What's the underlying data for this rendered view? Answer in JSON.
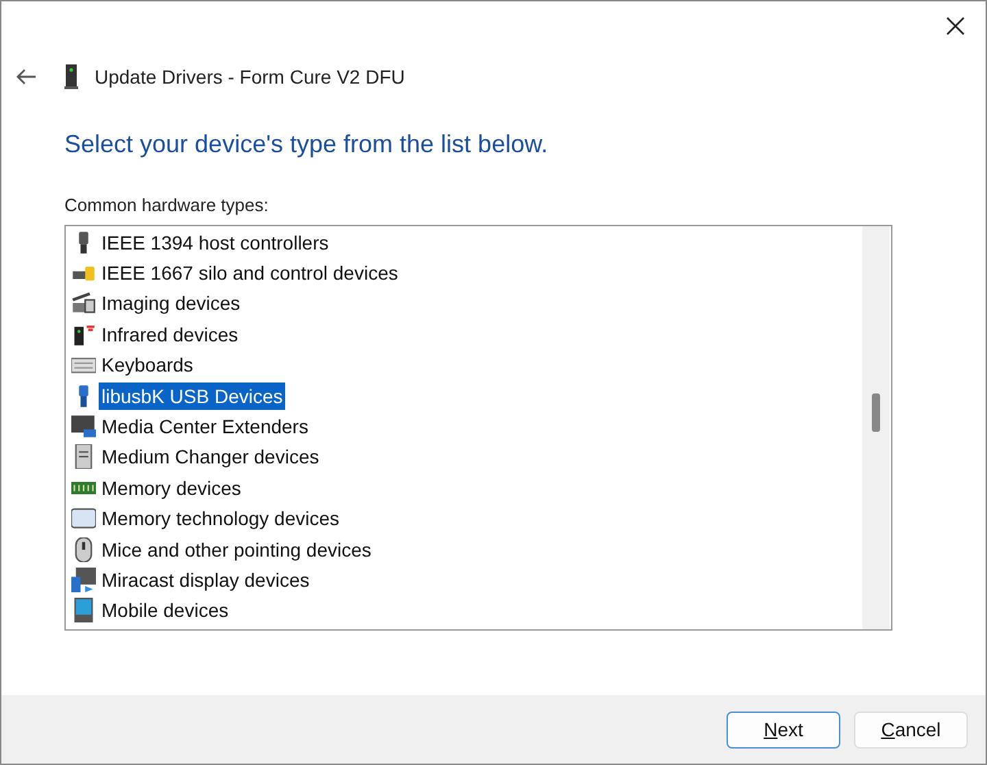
{
  "window": {
    "title": "Update Drivers - Form Cure V2 DFU"
  },
  "heading": "Select your device's type from the list below.",
  "list_label": "Common hardware types:",
  "items": [
    {
      "label": "IEEE 1394 host controllers",
      "selected": false
    },
    {
      "label": "IEEE 1667 silo and control devices",
      "selected": false
    },
    {
      "label": "Imaging devices",
      "selected": false
    },
    {
      "label": "Infrared devices",
      "selected": false
    },
    {
      "label": "Keyboards",
      "selected": false
    },
    {
      "label": "libusbK USB Devices",
      "selected": true
    },
    {
      "label": "Media Center Extenders",
      "selected": false
    },
    {
      "label": "Medium Changer devices",
      "selected": false
    },
    {
      "label": "Memory devices",
      "selected": false
    },
    {
      "label": "Memory technology devices",
      "selected": false
    },
    {
      "label": "Mice and other pointing devices",
      "selected": false
    },
    {
      "label": "Miracast display devices",
      "selected": false
    },
    {
      "label": "Mobile devices",
      "selected": false
    }
  ],
  "buttons": [
    {
      "label": "Next",
      "kind": "default"
    },
    {
      "label": "Cancel",
      "kind": "normal"
    }
  ]
}
